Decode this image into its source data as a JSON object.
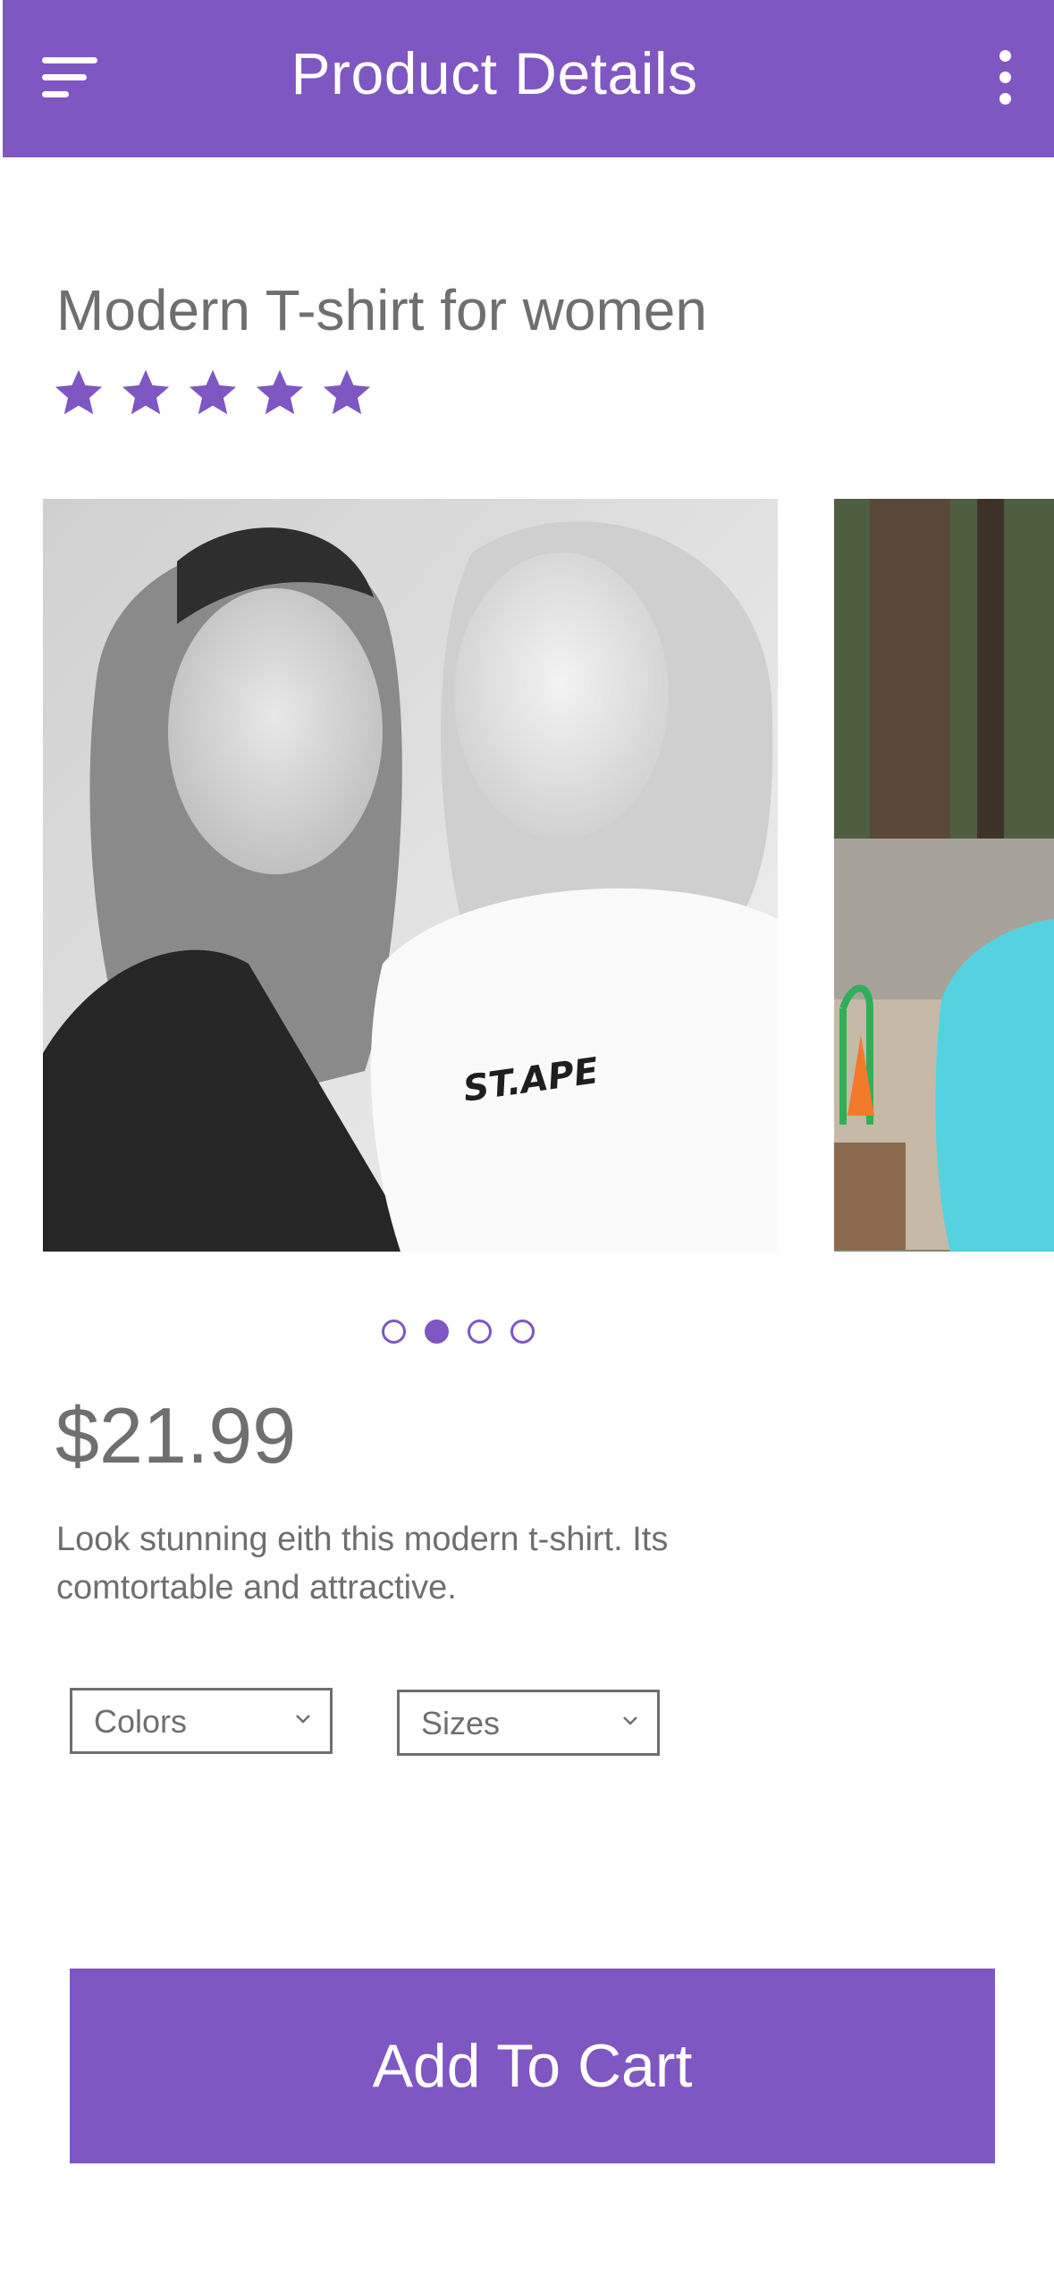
{
  "header": {
    "title": "Product Details",
    "menu_icon": "menu-icon",
    "more_icon": "more-vertical-icon",
    "background": "#7E57C2"
  },
  "product": {
    "title": "Modern T-shirt for women",
    "rating": 5,
    "rating_max": 5,
    "price": "$21.99",
    "description": "Look stunning eith this modern t-shirt. Its comtortable and attractive."
  },
  "carousel": {
    "image_count": 4,
    "active_index": 1,
    "shirt_print": "ST.APE"
  },
  "options": {
    "colors_label": "Colors",
    "sizes_label": "Sizes"
  },
  "actions": {
    "add_to_cart_label": "Add To Cart"
  },
  "colors": {
    "accent": "#7E57C2",
    "text_gray": "#6f6f6f"
  }
}
